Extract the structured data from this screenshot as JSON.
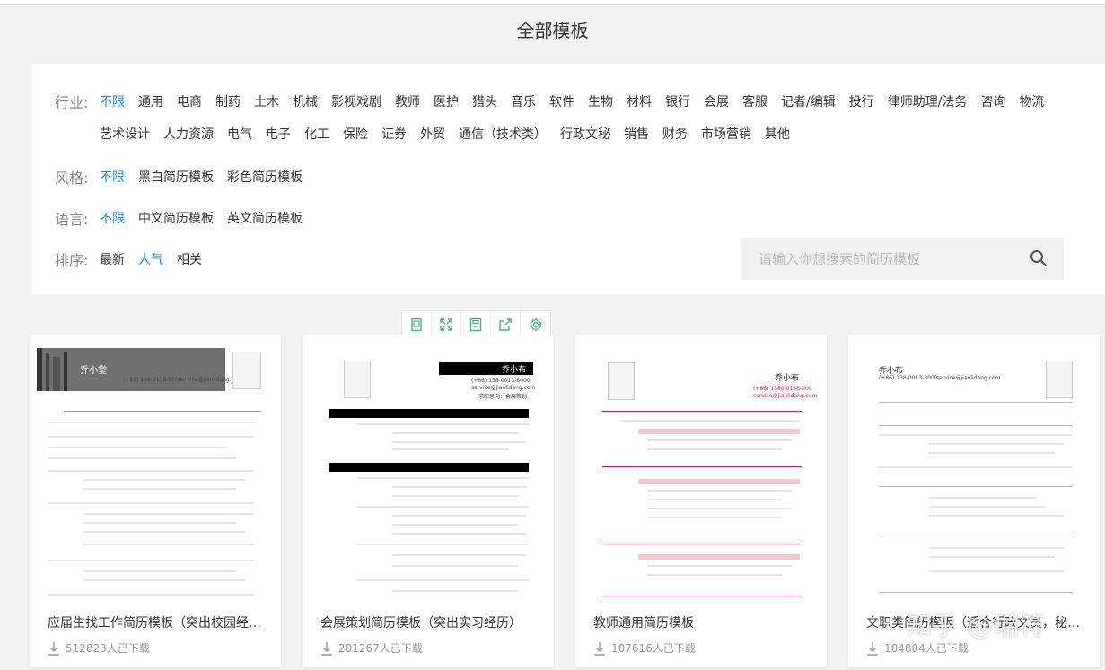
{
  "page_title": "全部模板",
  "filters": {
    "industry": {
      "label": "行业:",
      "options": [
        "不限",
        "通用",
        "电商",
        "制药",
        "土木",
        "机械",
        "影视戏剧",
        "教师",
        "医护",
        "猎头",
        "音乐",
        "软件",
        "生物",
        "材料",
        "银行",
        "会展",
        "客服",
        "记者/编辑",
        "投行",
        "律师助理/法务",
        "咨询",
        "物流",
        "艺术设计",
        "人力资源",
        "电气",
        "电子",
        "化工",
        "保险",
        "证券",
        "外贸",
        "通信（技术类）",
        "行政文秘",
        "销售",
        "财务",
        "市场营销",
        "其他"
      ],
      "active": "不限"
    },
    "style": {
      "label": "风格:",
      "options": [
        "不限",
        "黑白简历模板",
        "彩色简历模板"
      ],
      "active": "不限"
    },
    "language": {
      "label": "语言:",
      "options": [
        "不限",
        "中文简历模板",
        "英文简历模板"
      ],
      "active": "不限"
    },
    "sort": {
      "label": "排序:",
      "options": [
        "最新",
        "人气",
        "相关"
      ],
      "active": "人气"
    }
  },
  "search": {
    "placeholder": "请输入你想搜索的简历模板",
    "icon": "search-icon"
  },
  "toolbar_icons": [
    "preview-icon",
    "fullscreen-icon",
    "save-icon",
    "share-icon",
    "settings-icon"
  ],
  "cards": [
    {
      "title": "应届生找工作简历模板（突出校园经…",
      "downloads": "512823人已下载",
      "resume": {
        "name": "乔小堂",
        "contact": "(+86) 138-0138-0000",
        "email": "service@jianlidang.com"
      }
    },
    {
      "title": "会展策划简历模板（突出实习经历）",
      "downloads": "201267人已下载",
      "resume": {
        "name": "乔小布",
        "contact": "(+86) 138-0013-8000",
        "email": "service@jianlidang.com",
        "objective": "求职意向：会展策划"
      }
    },
    {
      "title": "教师通用简历模板",
      "downloads": "107616人已下载",
      "resume": {
        "name": "乔小布",
        "contact": "(+86) 1380-0138-000",
        "email": "service@jianlidang.com"
      }
    },
    {
      "title": "文职类简历模板（适合行政文员，秘书等）",
      "downloads": "104804人已下载",
      "resume": {
        "name": "乔小布",
        "contact": "(+86) 138-0013-8000",
        "email": "service@jianlidang.com"
      }
    }
  ],
  "watermark": "知乎 @瑞符",
  "colors": {
    "accent": "#1e88e5",
    "pink": "#c2185b",
    "toolbar_green": "#4caf78"
  }
}
